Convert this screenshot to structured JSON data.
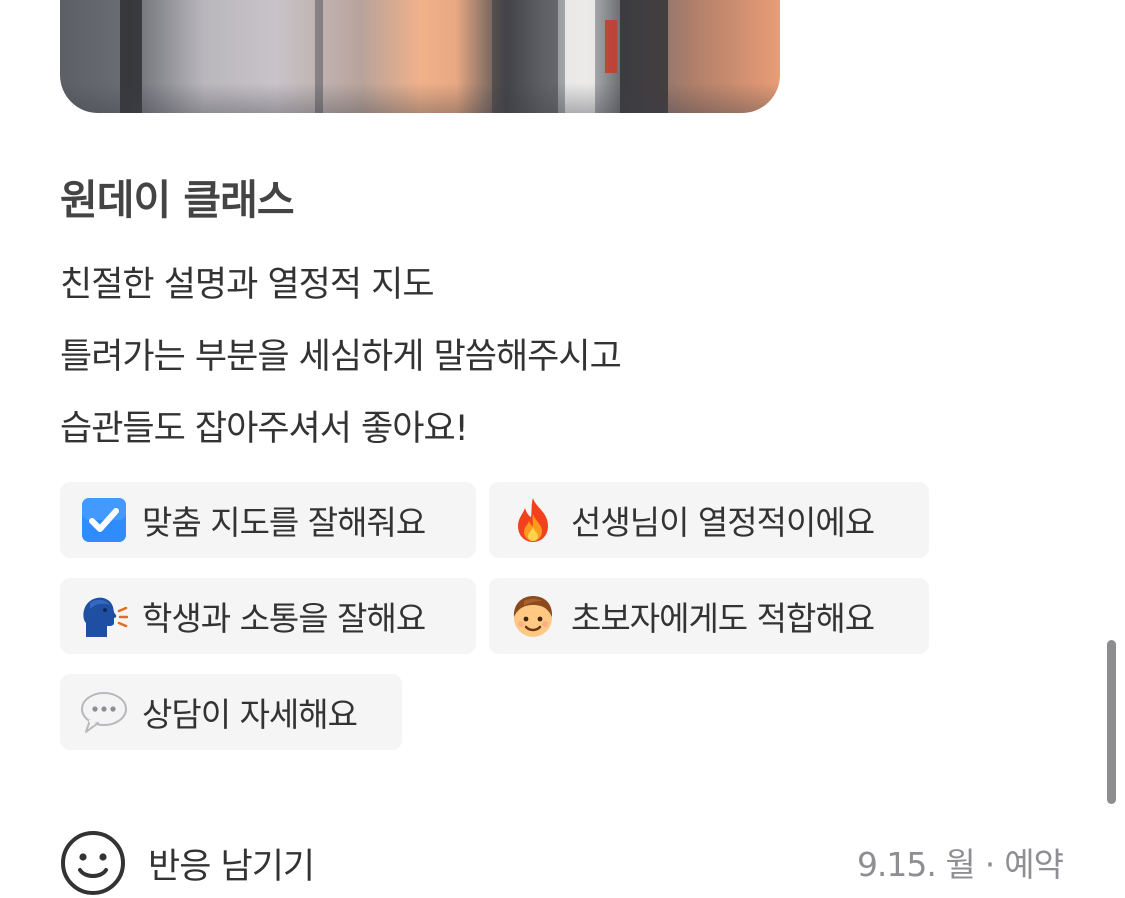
{
  "review_card": {
    "class_name": "원데이 클래스",
    "review_lines": [
      "친절한 설명과 열정적 지도",
      "틀려가는 부분을 세심하게 말씀해주시고",
      "습관들도 잡아주셔서 좋아요!"
    ],
    "tags": [
      {
        "icon": "check-box-icon",
        "label": "맞춤 지도를 잘해줘요"
      },
      {
        "icon": "fire-icon",
        "label": "선생님이 열정적이에요"
      },
      {
        "icon": "speaking-head-icon",
        "label": "학생과 소통을 잘해요"
      },
      {
        "icon": "boy-face-icon",
        "label": "초보자에게도 적합해요"
      },
      {
        "icon": "speech-bubble-icon",
        "label": "상담이 자세해요"
      }
    ],
    "reaction_label": "반응 남기기",
    "date": "9.15. 월",
    "separator": "·",
    "type_label": "예약"
  },
  "colors": {
    "tag_background": "#f5f5f6",
    "meta_text": "#8e8e93",
    "check_blue": "#2f8cff"
  }
}
